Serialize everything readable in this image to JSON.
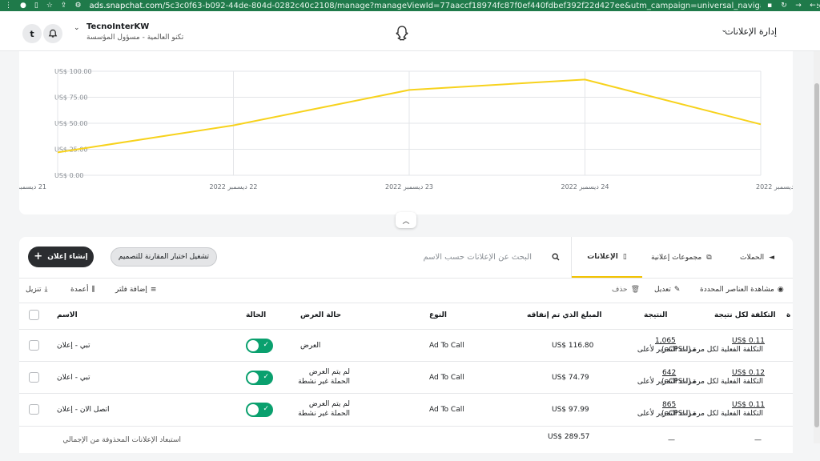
{
  "browser": {
    "url_host": "ads.snapchat.com",
    "url_path": "/5c3c0f63-b092-44de-804d-0282c40c2108/manage?manageViewId=77aaccf18974fc87f0ef440fdbef392f22d427ee&utm_campaign=universal_navigation&utm_medium..."
  },
  "header": {
    "avatar_letter": "t",
    "org_name": "TecnoInterKW",
    "org_subtitle": "تكنو العالمية - مسؤول المؤسسة",
    "ads_manager_label": "إدارة الإعلانات"
  },
  "chart_data": {
    "type": "line",
    "x": [
      "21 ديسمبر 2022",
      "22 ديسمبر 2022",
      "23 ديسمبر 2022",
      "24 ديسمبر 2022",
      "25 ديسمبر 2022"
    ],
    "series": [
      {
        "values": [
          22,
          48,
          82,
          92,
          49
        ]
      }
    ],
    "yticks": [
      "US$ 0.00",
      "US$ 25.00",
      "US$ 50.00",
      "US$ 75.00",
      "US$ 100.00"
    ],
    "ylim": [
      0,
      100
    ],
    "color": "#f7d21c",
    "grid": true
  },
  "toolbar": {
    "create_ad": "إنشاء إعلان",
    "ab_test": "تشغيل اختبار المقارنة للتصميم",
    "search_placeholder": "البحث عن الإعلانات حسب الاسم"
  },
  "tabs": [
    {
      "label": "الحملات",
      "icon": "megaphone-icon"
    },
    {
      "label": "مجموعات إعلانية",
      "icon": "copy-icon"
    },
    {
      "label": "الإعلانات",
      "icon": "phone-icon",
      "active": true
    }
  ],
  "actions": {
    "view_selected": "مشاهدة العناصر المحددة",
    "edit": "تعديل",
    "delete": "حذف",
    "add_filter": "إضافة فلتر",
    "columns": "أعمدة",
    "download": "تنزيل"
  },
  "columns": {
    "name": "الاسم",
    "status": "الحالة",
    "delivery": "حالة العرض",
    "type": "النوع",
    "spend": "المبلغ الذي تم إنفاقه",
    "result": "النتيجة",
    "cost_per_result": "التكلفة لكل نتيجة",
    "cut": "ة"
  },
  "rows": [
    {
      "name": "تبي - إعلان",
      "delivery_1": "العرض",
      "delivery_2": "",
      "type": "Ad To Call",
      "spend": "US$ 116.80",
      "result": "1,065",
      "result_sub": "مرات التمرير لأعلى",
      "cpr": "US$ 0.11",
      "cpr_sub": "التكلفة الفعلية لكل مرة (eCPSU)"
    },
    {
      "name": "تبي - اعلان",
      "delivery_1": "لم يتم العرض",
      "delivery_2": "الحملة غير نشطة",
      "type": "Ad To Call",
      "spend": "US$ 74.79",
      "result": "642",
      "result_sub": "مرات التمرير لأعلى",
      "cpr": "US$ 0.12",
      "cpr_sub": "التكلفة الفعلية لكل مرة (eCPSU)"
    },
    {
      "name": "اتصل الان - إعلان",
      "delivery_1": "لم يتم العرض",
      "delivery_2": "الحملة غير نشطة",
      "type": "Ad To Call",
      "spend": "US$ 97.99",
      "result": "865",
      "result_sub": "مرات التمرير لأعلى",
      "cpr": "US$ 0.11",
      "cpr_sub": "التكلفة الفعلية لكل مرة (eCPSU)"
    }
  ],
  "total": {
    "label": "استبعاد الإعلانات المحذوفة من الإجمالي",
    "spend": "US$ 289.57",
    "dash": "—"
  }
}
